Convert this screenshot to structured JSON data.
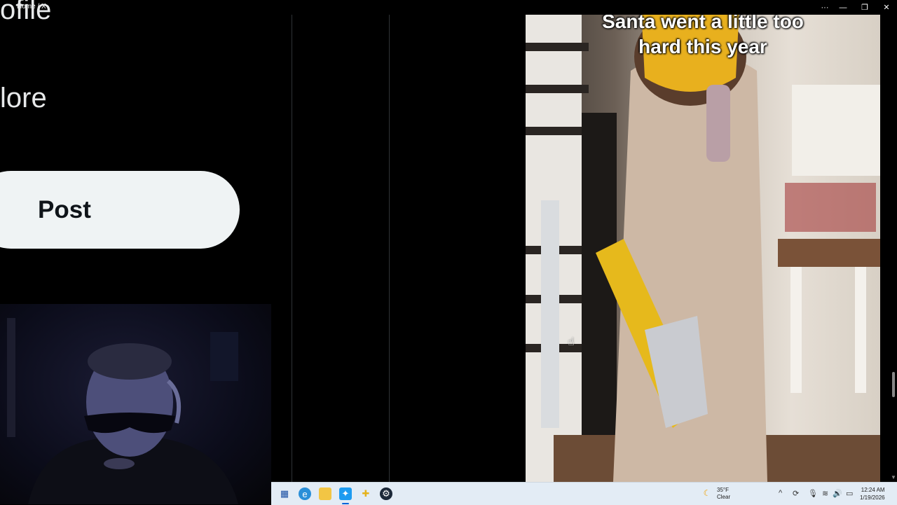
{
  "window": {
    "title": "Home / X",
    "controls": {
      "more": "···",
      "minimize": "—",
      "restore": "❐",
      "close": "✕"
    }
  },
  "sidebar": {
    "items": [
      {
        "label": "ofile"
      },
      {
        "label": "lore"
      }
    ],
    "post_label": "Post"
  },
  "media": {
    "caption_line1": "Santa went a little too",
    "caption_line2": "hard this year"
  },
  "taskbar": {
    "icons": [
      "start-icon",
      "edge-icon",
      "file-explorer-icon",
      "twitter-icon",
      "pinned-app-icon",
      "steam-icon"
    ],
    "weather_temp": "35°F",
    "weather_cond": "Clear",
    "time": "12:24 AM",
    "date": "1/19/2026"
  },
  "colors": {
    "background": "#000000",
    "post_button": "#eff3f4",
    "taskbar": "#e3ecf5",
    "caption_text": "#ffffff"
  }
}
